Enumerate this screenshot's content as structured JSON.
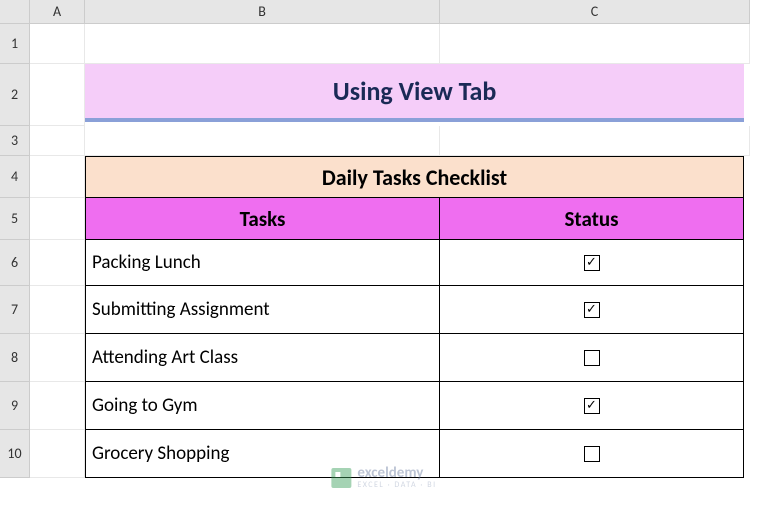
{
  "columns": [
    "A",
    "B",
    "C"
  ],
  "rows": [
    "1",
    "2",
    "3",
    "4",
    "5",
    "6",
    "7",
    "8",
    "9",
    "10"
  ],
  "title": "Using View Tab",
  "section_header": "Daily Tasks Checklist",
  "col_headers": {
    "tasks": "Tasks",
    "status": "Status"
  },
  "tasks": [
    {
      "name": "Packing Lunch",
      "done": true
    },
    {
      "name": "Submitting Assignment",
      "done": true
    },
    {
      "name": "Attending Art Class",
      "done": false
    },
    {
      "name": "Going to Gym",
      "done": true
    },
    {
      "name": "Grocery Shopping",
      "done": false
    }
  ],
  "watermark": {
    "brand": "exceldemy",
    "tagline": "EXCEL · DATA · BI"
  },
  "checkmark": "✓"
}
